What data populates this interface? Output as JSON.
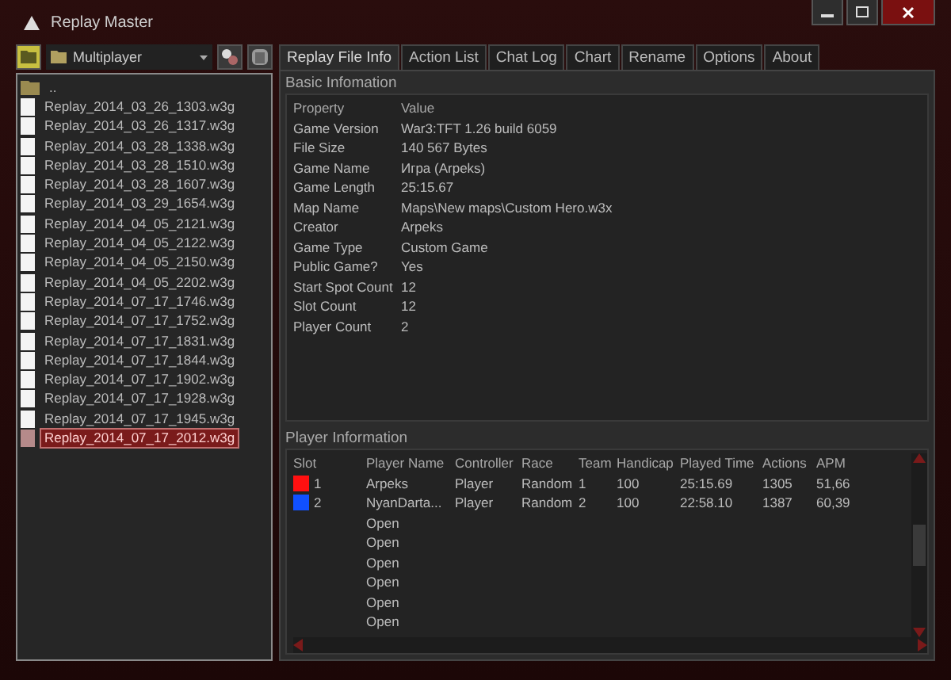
{
  "window": {
    "title": "Replay Master"
  },
  "folder_select": {
    "value": "Multiplayer"
  },
  "files": [
    {
      "name": "..",
      "kind": "folder",
      "selected": false
    },
    {
      "name": "Replay_2014_03_26_1303.w3g",
      "kind": "file",
      "selected": false
    },
    {
      "name": "Replay_2014_03_26_1317.w3g",
      "kind": "file",
      "selected": false
    },
    {
      "name": "Replay_2014_03_28_1338.w3g",
      "kind": "file",
      "selected": false
    },
    {
      "name": "Replay_2014_03_28_1510.w3g",
      "kind": "file",
      "selected": false
    },
    {
      "name": "Replay_2014_03_28_1607.w3g",
      "kind": "file",
      "selected": false
    },
    {
      "name": "Replay_2014_03_29_1654.w3g",
      "kind": "file",
      "selected": false
    },
    {
      "name": "Replay_2014_04_05_2121.w3g",
      "kind": "file",
      "selected": false
    },
    {
      "name": "Replay_2014_04_05_2122.w3g",
      "kind": "file",
      "selected": false
    },
    {
      "name": "Replay_2014_04_05_2150.w3g",
      "kind": "file",
      "selected": false
    },
    {
      "name": "Replay_2014_04_05_2202.w3g",
      "kind": "file",
      "selected": false
    },
    {
      "name": "Replay_2014_07_17_1746.w3g",
      "kind": "file",
      "selected": false
    },
    {
      "name": "Replay_2014_07_17_1752.w3g",
      "kind": "file",
      "selected": false
    },
    {
      "name": "Replay_2014_07_17_1831.w3g",
      "kind": "file",
      "selected": false
    },
    {
      "name": "Replay_2014_07_17_1844.w3g",
      "kind": "file",
      "selected": false
    },
    {
      "name": "Replay_2014_07_17_1902.w3g",
      "kind": "file",
      "selected": false
    },
    {
      "name": "Replay_2014_07_17_1928.w3g",
      "kind": "file",
      "selected": false
    },
    {
      "name": "Replay_2014_07_17_1945.w3g",
      "kind": "file",
      "selected": false
    },
    {
      "name": "Replay_2014_07_17_2012.w3g",
      "kind": "file",
      "selected": true
    }
  ],
  "tabs": [
    {
      "label": "Replay File Info",
      "selected": true
    },
    {
      "label": "Action List",
      "selected": false
    },
    {
      "label": "Chat Log",
      "selected": false
    },
    {
      "label": "Chart",
      "selected": false
    },
    {
      "label": "Rename",
      "selected": false
    },
    {
      "label": "Options",
      "selected": false
    },
    {
      "label": "About",
      "selected": false
    }
  ],
  "basic_info": {
    "title": "Basic Infomation",
    "columns": [
      "Property",
      "Value"
    ],
    "rows": [
      [
        "Game Version",
        "War3:TFT 1.26 build 6059"
      ],
      [
        "File Size",
        "140 567 Bytes"
      ],
      [
        "Game Name",
        "Игра (Arpeks)"
      ],
      [
        "Game Length",
        "25:15.67"
      ],
      [
        "Map Name",
        "Maps\\New maps\\Custom Hero.w3x"
      ],
      [
        "Creator",
        "Arpeks"
      ],
      [
        "Game Type",
        "Custom Game"
      ],
      [
        "Public Game?",
        "Yes"
      ],
      [
        "Start Spot Count",
        "12"
      ],
      [
        "Slot Count",
        "12"
      ],
      [
        "Player Count",
        "2"
      ]
    ]
  },
  "player_info": {
    "title": "Player Information",
    "columns": [
      "Slot",
      "Player Name",
      "Controller",
      "Race",
      "Team",
      "Handicap",
      "Played Time",
      "Actions",
      "APM"
    ],
    "rows": [
      {
        "kind": "player",
        "color": "#ff1010",
        "cells": [
          "1",
          "Arpeks",
          "Player",
          "Random",
          "1",
          "100",
          "25:15.69",
          "1305",
          "51,66"
        ]
      },
      {
        "kind": "player",
        "color": "#1050ff",
        "cells": [
          "2",
          "NyanDarta...",
          "Player",
          "Random",
          "2",
          "100",
          "22:58.10",
          "1387",
          "60,39"
        ]
      },
      {
        "kind": "open",
        "cells": [
          "Open"
        ]
      },
      {
        "kind": "open",
        "cells": [
          "Open"
        ]
      },
      {
        "kind": "open",
        "cells": [
          "Open"
        ]
      },
      {
        "kind": "open",
        "cells": [
          "Open"
        ]
      },
      {
        "kind": "open",
        "cells": [
          "Open"
        ]
      },
      {
        "kind": "open",
        "cells": [
          "Open"
        ]
      }
    ]
  }
}
